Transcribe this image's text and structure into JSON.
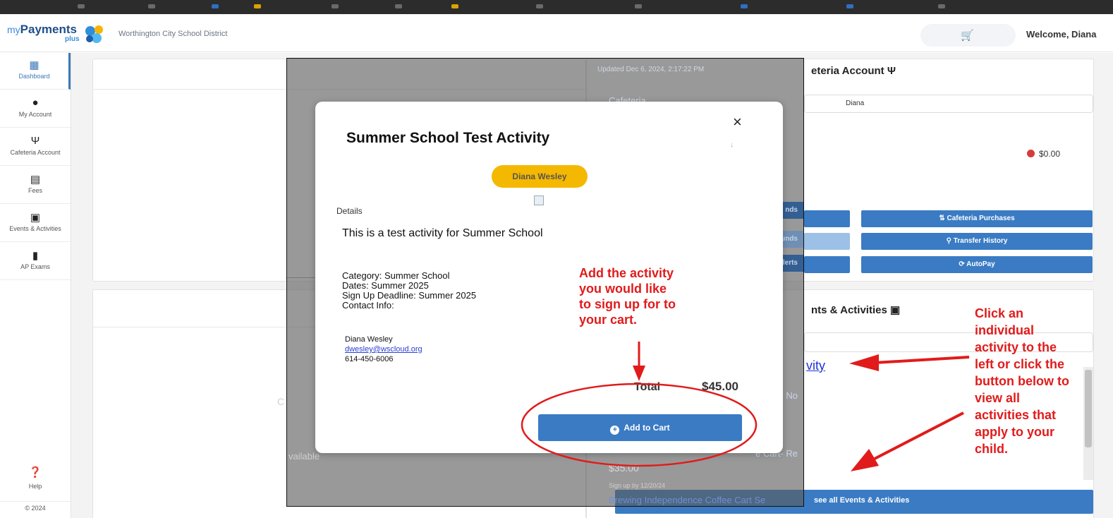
{
  "header": {
    "logo_my": "my",
    "logo_payments": "Payments",
    "logo_plus": "plus",
    "district": "Worthington City School District",
    "welcome": "Welcome, Diana"
  },
  "sidebar": {
    "items": [
      {
        "label": "Dashboard",
        "icon": "dashboard-icon"
      },
      {
        "label": "My Account",
        "icon": "account-icon"
      },
      {
        "label": "Cafeteria Account",
        "icon": "fork-knife-icon"
      },
      {
        "label": "Fees",
        "icon": "clipboard-icon"
      },
      {
        "label": "Events & Activities",
        "icon": "ticket-icon"
      },
      {
        "label": "AP Exams",
        "icon": "book-icon"
      }
    ],
    "help": "Help",
    "copyright": "© 2024"
  },
  "background": {
    "updated": "Updated Dec 6, 2024, 2:17:22 PM",
    "cafeteria_title": "eteria Account",
    "cafeteria_label": "Cafeteria",
    "student_select": "Diana",
    "balance": "$0.00",
    "btn_cafeteria_purchases": "Cafeteria Purchases",
    "btn_transfer_history": "Transfer History",
    "btn_autopay": "AutoPay",
    "ghost_funds": "nds",
    "ghost_funds2": "unds",
    "ghost_alerts": "e Alerts",
    "events_title": "nts & Activities",
    "activity_link": "vity",
    "under_cart_no": "e Cart- No",
    "under_cart_re": "e Cart- Re",
    "under_price": "$35.00",
    "under_signup": "Sign up by 12/20/24",
    "under_faded": "Brewing Independence Coffee Cart Se",
    "see_all": "see all Events & Activities",
    "left_c": "C",
    "left_available": "vailable"
  },
  "modal": {
    "title": "Summer School Test Activity",
    "close": "×",
    "student": "Diana Wesley",
    "details_label": "Details",
    "description": "This is a test activity for Summer School",
    "category": "Category: Summer School",
    "dates": "Dates: Summer 2025",
    "deadline": "Sign Up Deadline: Summer 2025",
    "contact_info": "Contact Info:",
    "contact_name": "Diana Wesley",
    "contact_email": "dwesley@wscloud.org",
    "contact_phone": "614-450-6006",
    "total_label": "Total",
    "total_value": "$45.00",
    "add_to_cart": "Add to Cart"
  },
  "annotations": {
    "left_lines": [
      "Add the activity",
      "you would like",
      "to sign up for to",
      "your cart."
    ],
    "right_lines": [
      "Click an",
      "individual",
      "activity to the",
      "left or click the",
      "button below to",
      "view all",
      "activities that",
      "apply to your",
      "child."
    ],
    "color": "#e11b1b"
  }
}
